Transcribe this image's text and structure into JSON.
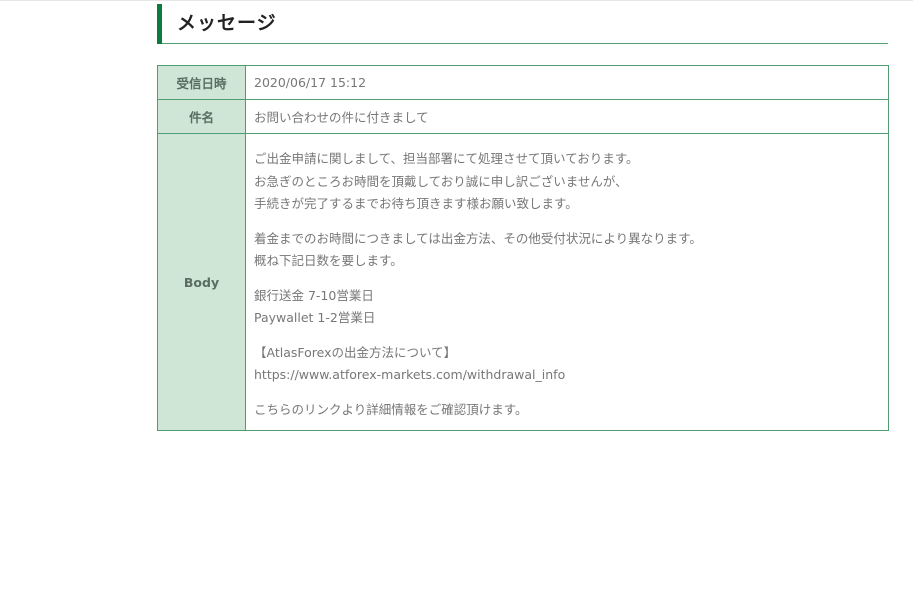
{
  "heading": {
    "title": "メッセージ"
  },
  "message": {
    "date_label": "受信日時",
    "date_value": "2020/06/17 15:12",
    "subject_label": "件名",
    "subject_value": "お問い合わせの件に付きまして",
    "body_label": "Body",
    "body_paragraphs": [
      {
        "lines": [
          "ご出金申請に関しまして、担当部署にて処理させて頂いております。",
          "お急ぎのところお時間を頂戴しており誠に申し訳ございませんが、",
          "手続きが完了するまでお待ち頂きます様お願い致します。"
        ]
      },
      {
        "lines": [
          "着金までのお時間につきましては出金方法、その他受付状況により異なります。",
          "概ね下記日数を要します。"
        ]
      },
      {
        "lines": [
          "銀行送金 7-10営業日",
          "Paywallet 1-2営業日"
        ]
      },
      {
        "lines": [
          "【AtlasForexの出金方法について】",
          "https://www.atforex-markets.com/withdrawal_info"
        ]
      },
      {
        "lines": [
          "こちらのリンクより詳細情報をご確認頂けます。"
        ]
      }
    ]
  }
}
